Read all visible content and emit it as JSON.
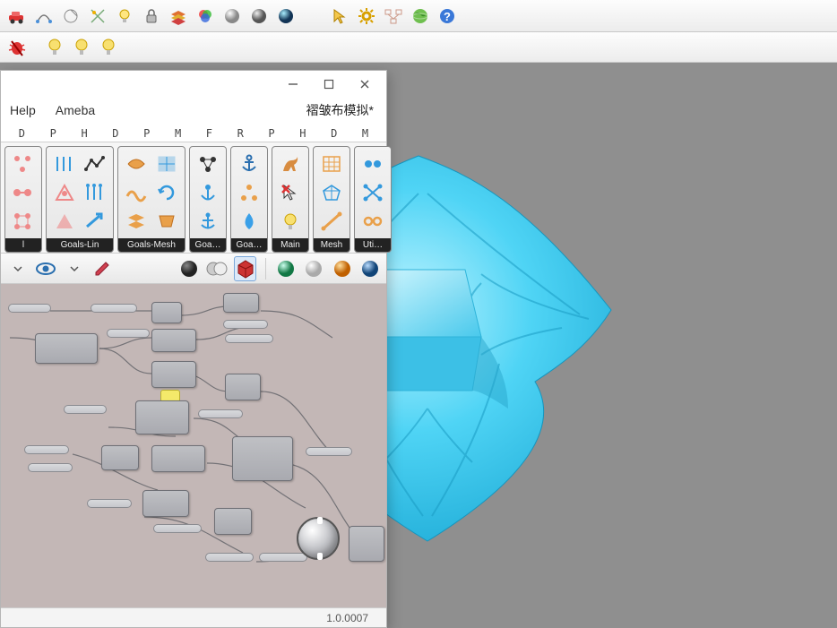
{
  "rhino_toolbar": {
    "icons": [
      "car-icon",
      "arc-icon",
      "arc2-icon",
      "trim-icon",
      "lightbulb-icon",
      "lock-icon",
      "layers-icon",
      "circle-rgb-icon",
      "sphere-matcap-icon",
      "sphere-shadow-icon",
      "sphere-blue-icon",
      "null-icon",
      "cursor-icon",
      "gear-icon",
      "diagram-icon",
      "globe-icon",
      "help-icon"
    ]
  },
  "rhino_subbar": {
    "icons": [
      "bug-red-icon",
      "bulb-yellow-icon",
      "bulb-yellow2-icon",
      "bulb-yellow3-icon"
    ]
  },
  "gh": {
    "menu": {
      "help": "Help",
      "ameba": "Ameba"
    },
    "doc_title": "褶皱布模拟*",
    "tab_letters": [
      "D",
      "P",
      "H",
      "D",
      "P",
      "M",
      "F",
      "R",
      "P",
      "H",
      "D",
      "M"
    ],
    "ribbon_groups": [
      {
        "label": "l",
        "cols": "single",
        "icons": [
          "dots-orange",
          "dots-blue",
          "dots-orange2"
        ]
      },
      {
        "label": "Goals-Lin",
        "cols": "2",
        "icons": [
          "bars-blue",
          "graph-black",
          "tri-orange",
          "bars2-blue",
          "tri2-orange",
          "arrow-blue"
        ]
      },
      {
        "label": "Goals-Mesh",
        "cols": "2",
        "icons": [
          "swirl-orange",
          "mesh-blue",
          "wave-orange",
          "cycle-blue",
          "quad-orange",
          "quad2-orange"
        ]
      },
      {
        "label": "Goa…",
        "cols": "single",
        "icons": [
          "anchor-dots",
          "anchor-blue",
          "anchor-blue2"
        ]
      },
      {
        "label": "Goa…",
        "cols": "single",
        "icons": [
          "anchor-icon",
          "tri-dots",
          "drop-blue"
        ]
      },
      {
        "label": "Main",
        "cols": "single",
        "icons": [
          "kangaroo-icon",
          "cursor-red-icon",
          "bulb-icon"
        ]
      },
      {
        "label": "Mesh",
        "cols": "single",
        "icons": [
          "grid-orange",
          "polygon-blue",
          "line-orange"
        ]
      },
      {
        "label": "Uti…",
        "cols": "single",
        "icons": [
          "link-blue",
          "cross-blue",
          "chain-orange"
        ]
      }
    ],
    "canvas_toolbar": {
      "left": [
        "chevron-down-icon",
        "eye-icon",
        "chevron-down-icon",
        "pencil-icon"
      ],
      "mid": [
        "disc-dark-icon",
        "discs-icon",
        "cube-red-icon"
      ],
      "right": [
        "sphere-green-icon",
        "sphere-white-icon",
        "sphere-orange-icon",
        "sphere-blue-icon"
      ]
    },
    "version": "1.0.0007"
  }
}
